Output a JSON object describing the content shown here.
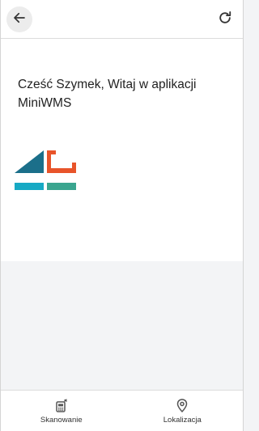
{
  "topbar": {
    "back_icon": "arrow-left-icon",
    "refresh_icon": "refresh-icon"
  },
  "main": {
    "greeting": "Cześć Szymek, Witaj w aplikacji MiniWMS",
    "logo_colors": {
      "triangle": "#1b6f8a",
      "bracket": "#e8542a",
      "bar_left": "#17a9c4",
      "bar_right": "#3aa58f"
    }
  },
  "bottom_nav": {
    "items": [
      {
        "label": "Skanowanie",
        "icon": "scanner-icon"
      },
      {
        "label": "Lokalizacja",
        "icon": "location-pin-icon"
      }
    ]
  }
}
